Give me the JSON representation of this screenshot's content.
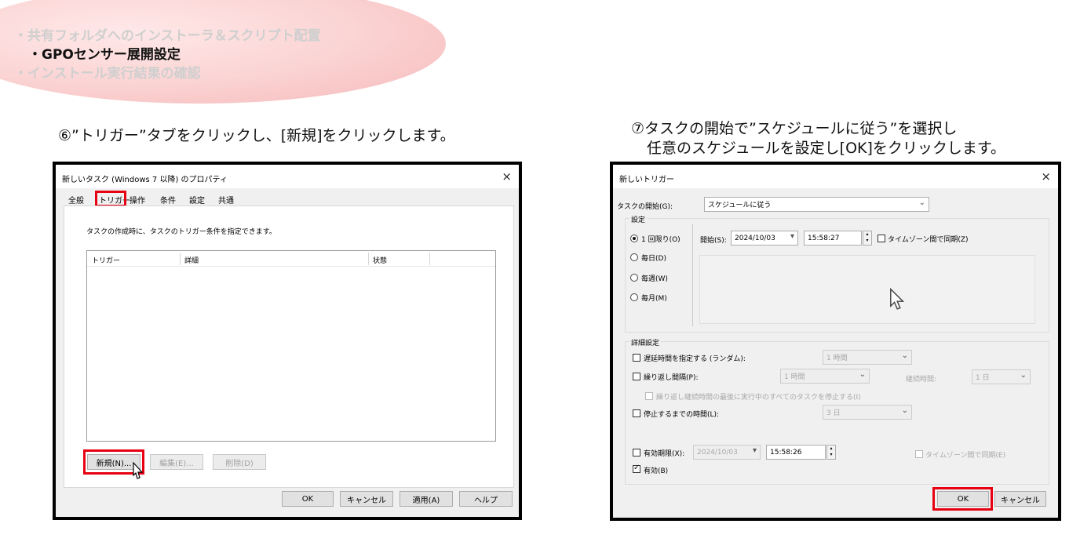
{
  "header": {
    "items": [
      "・共有フォルダへのインストーラ＆スクリプト配置",
      "・GPOセンサー展開設定",
      "・インストール実行結果の確認"
    ],
    "active_index": 1
  },
  "steps": {
    "step6": "⑥”トリガー”タブをクリックし、[新規]をクリックします。",
    "step7_line1": "⑦タスクの開始で”スケジュールに従う”を選択し",
    "step7_line2": "任意のスケジュールを設定し[OK]をクリックします。"
  },
  "left_dialog": {
    "title": "新しいタスク (Windows 7 以降) のプロパティ",
    "close": "×",
    "tabs": [
      "全般",
      "トリガー",
      "操作",
      "条件",
      "設定",
      "共通"
    ],
    "active_tab": "トリガー",
    "description": "タスクの作成時に、タスクのトリガー条件を指定できます。",
    "columns": [
      "トリガー",
      "詳細",
      "状態"
    ],
    "new_button": "新規(N)...",
    "edit_button": "編集(E)...",
    "delete_button": "削除(D)",
    "ok": "OK",
    "cancel": "キャンセル",
    "apply": "適用(A)",
    "help": "ヘルプ"
  },
  "right_dialog": {
    "title": "新しいトリガー",
    "close": "×",
    "start_label": "タスクの開始(G):",
    "start_value": "スケジュールに従う",
    "settings_label": "設定",
    "radios": [
      "1 回限り(O)",
      "毎日(D)",
      "毎週(W)",
      "毎月(M)"
    ],
    "start_time_label": "開始(S):",
    "start_date": "2024/10/03",
    "start_time": "15:58:27",
    "sync_timezone": "タイムゾーン間で同期(Z)",
    "advanced_label": "詳細設定",
    "delay_label": "遅延時間を指定する (ランダム):",
    "delay_value": "1 時間",
    "repeat_label": "繰り返し間隔(P):",
    "repeat_value": "1 時間",
    "duration_label": "継続時間:",
    "duration_value": "1 日",
    "stop_all_label": "繰り返し継続時間の最後に実行中のすべてのタスクを停止する(I)",
    "stop_after_label": "停止するまでの時間(L):",
    "stop_after_value": "3 日",
    "expire_label": "有効期限(X):",
    "expire_date": "2024/10/03",
    "expire_time": "15:58:26",
    "expire_sync": "タイムゾーン間で同期(E)",
    "enabled_label": "有効(B)",
    "ok": "OK",
    "cancel": "キャンセル"
  }
}
